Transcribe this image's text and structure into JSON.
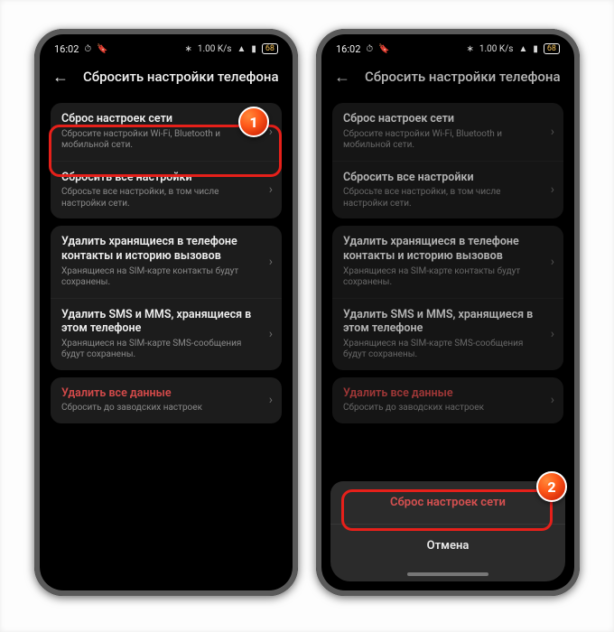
{
  "statusbar": {
    "time": "16:02",
    "speed": "1.00 K/s",
    "battery": "68"
  },
  "header": {
    "title": "Сбросить настройки телефона"
  },
  "rows": {
    "network": {
      "title": "Сброс настроек сети",
      "sub": "Сбросите настройки Wi-Fi, Bluetooth и мобильной сети."
    },
    "all_settings": {
      "title": "Сбросить все настройки",
      "sub": "Сбросьте все настройки, в том числе настройки сети."
    },
    "contacts": {
      "title": "Удалить хранящиеся в телефоне контакты и историю вызовов",
      "sub": "Хранящиеся на SIM-карте контакты будут сохранены."
    },
    "sms": {
      "title": "Удалить SMS и MMS, хранящиеся в этом телефоне",
      "sub": "Хранящиеся на SIM-карте SMS-сообщения будут сохранены."
    },
    "erase": {
      "title": "Удалить все данные",
      "sub": "Сбросить до заводских настроек"
    }
  },
  "sheet": {
    "confirm": "Сброс настроек сети",
    "cancel": "Отмена"
  },
  "badges": {
    "one": "1",
    "two": "2"
  }
}
